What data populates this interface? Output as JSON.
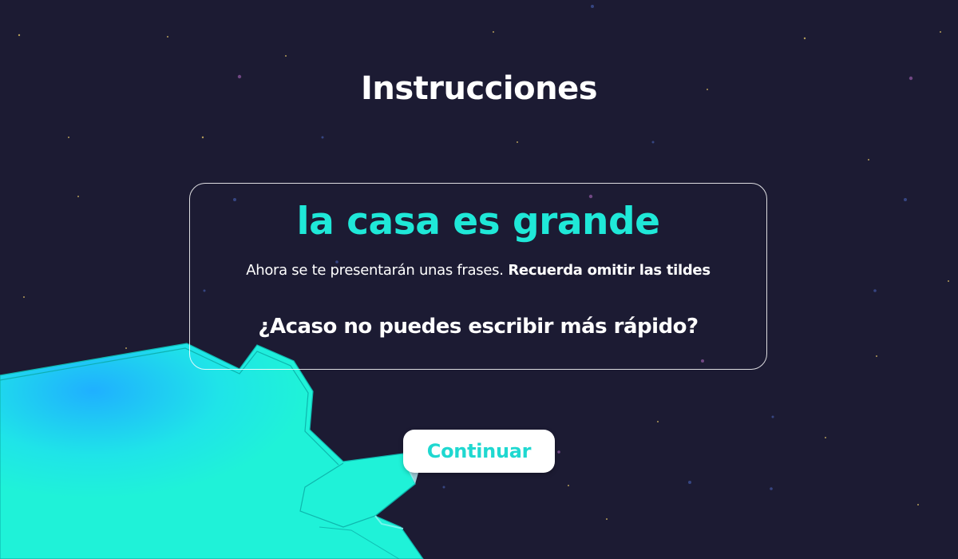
{
  "page": {
    "title": "Instrucciones"
  },
  "card": {
    "phrase": "la casa es grande",
    "instruction_text": "Ahora se te presentarán unas frases.",
    "instruction_emphasis": "Recuerda omitir las tildes",
    "challenge": "¿Acaso no puedes escribir más rápido?"
  },
  "actions": {
    "continue_label": "Continuar"
  },
  "colors": {
    "background": "#1c1b33",
    "accent": "#1fe8d8",
    "planet": "#1ff0d8",
    "button_bg": "#ffffff",
    "text": "#ffffff"
  },
  "icons": {
    "planet": "planet-illustration",
    "stars": "star-sparkles"
  }
}
